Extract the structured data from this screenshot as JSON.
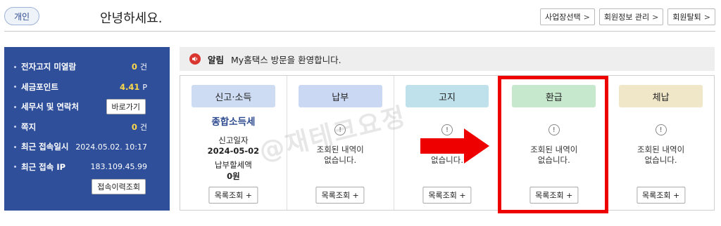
{
  "header": {
    "user_type": "개인",
    "greeting": "안녕하세요.",
    "buttons": [
      {
        "label": "사업장선택"
      },
      {
        "label": "회원정보 관리"
      },
      {
        "label": "회원탈퇴"
      }
    ],
    "chevron": ">"
  },
  "left_panel": {
    "rows": [
      {
        "label": "전자고지 미열람",
        "value": "0",
        "unit": "건"
      },
      {
        "label": "세금포인트",
        "value": "4.41",
        "unit": "P"
      },
      {
        "label": "세무서 및 연락처",
        "button": "바로가기"
      },
      {
        "label": "쪽지",
        "value": "0",
        "unit": "건"
      },
      {
        "label": "최근 접속일시",
        "text": "2024.05.02.  10:17"
      },
      {
        "label": "최근 접속 IP",
        "text": "183.109.45.99"
      }
    ],
    "history_button": "접속이력조회"
  },
  "notice": {
    "label": "알림",
    "text": "My홈택스 방문을 환영합니다."
  },
  "columns": [
    {
      "title": "신고·소득",
      "color": "#cddcf3",
      "tax_name": "종합소득세",
      "date_label": "신고일자",
      "date": "2024-05-02",
      "amount_label": "납부할세액",
      "amount": "0원",
      "button": "목록조회 +"
    },
    {
      "title": "납부",
      "color": "#cbd8f3",
      "empty": [
        "조회된 내역이",
        "없습니다."
      ],
      "button": "목록조회 +"
    },
    {
      "title": "고지",
      "color": "#bfe1ec",
      "empty": [
        "조회된 내역이",
        "없습니다."
      ],
      "button": "목록조회 +"
    },
    {
      "title": "환급",
      "color": "#c6e8cc",
      "empty": [
        "조회된 내역이",
        "없습니다."
      ],
      "button": "목록조회 +"
    },
    {
      "title": "체납",
      "color": "#f0e6c8",
      "empty": [
        "조회된 내역이",
        "없습니다."
      ],
      "button": "목록조회 +"
    }
  ],
  "watermark": "@재테크요정",
  "colors": {
    "panel": "#2f4f9b",
    "accent_yellow": "#ffd84a",
    "highlight_red": "#ee0000"
  }
}
